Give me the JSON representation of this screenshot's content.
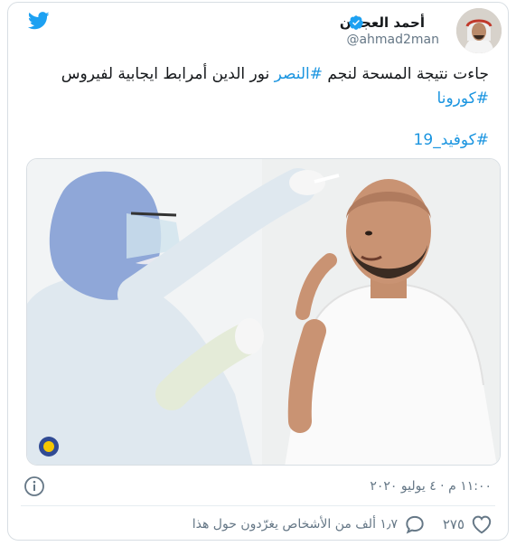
{
  "author": {
    "display_name": "أحمد العجلان",
    "handle": "@ahmad2man",
    "verified": true
  },
  "tweet": {
    "text_plain_1": "جاءت نتيجة المسحة لنجم ",
    "hashtag_1": "#النصر",
    "text_plain_2": " نور الدين أمرابط ايجابية لفيروس ",
    "hashtag_2": "#كورونا",
    "hashtag_3": "#كوفيد_19"
  },
  "meta": {
    "timestamp": "١١:٠٠ م · ٤ يوليو ٢٠٢٠"
  },
  "actions": {
    "like_count": "٢٧٥",
    "reply_text": "١٫٧ ألف من الأشخاص يغرّدون حول هذا"
  },
  "colors": {
    "brand": "#1da1f2",
    "link": "#1b95e0",
    "muted": "#657786",
    "border": "#d8dee3"
  },
  "icons": [
    "twitter-bird-icon",
    "verified-badge-icon",
    "info-icon",
    "heart-icon",
    "speech-bubble-icon"
  ]
}
